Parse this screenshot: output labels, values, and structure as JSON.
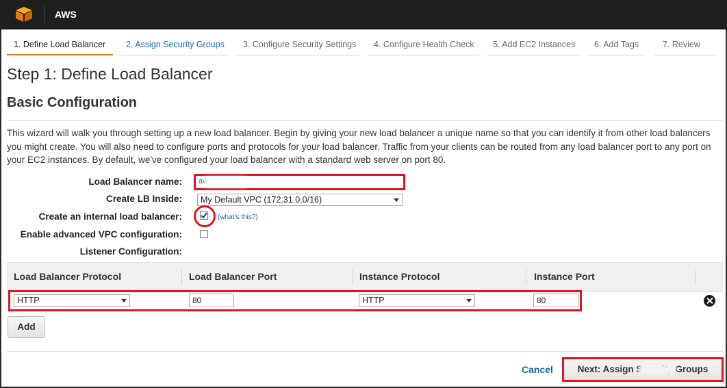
{
  "app": {
    "brand": "AWS"
  },
  "wizard": {
    "tabs": [
      {
        "label": "1. Define Load Balancer",
        "state": "active"
      },
      {
        "label": "2. Assign Security Groups",
        "state": "link"
      },
      {
        "label": "3. Configure Security Settings",
        "state": "inactive"
      },
      {
        "label": "4. Configure Health Check",
        "state": "inactive"
      },
      {
        "label": "5. Add EC2 Instances",
        "state": "inactive"
      },
      {
        "label": "6. Add Tags",
        "state": "inactive"
      },
      {
        "label": "7. Review",
        "state": "inactive"
      }
    ],
    "accent_color": "#e47911"
  },
  "page": {
    "step_title": "Step 1: Define Load Balancer",
    "section_title": "Basic Configuration",
    "intro": "This wizard will walk you through setting up a new load balancer. Begin by giving your new load balancer a unique name so that you can identify it from other load balancers you might create. You will also need to configure ports and protocols for your load balancer. Traffic from your clients can be routed from any load balancer port to any port on your EC2 instances. By default, we've configured your load balancer with a standard web server on port 80."
  },
  "form": {
    "name_label": "Load Balancer name:",
    "name_value": "aw",
    "inside_label": "Create LB Inside:",
    "inside_value": "My Default VPC (172.31.0.0/16)",
    "internal_label": "Create an internal load balancer:",
    "internal_checked": true,
    "whats_this": "(what's this?)",
    "advanced_label": "Enable advanced VPC configuration:",
    "advanced_checked": false,
    "listener_label": "Listener Configuration:"
  },
  "listeners": {
    "headers": [
      "Load Balancer Protocol",
      "Load Balancer Port",
      "Instance Protocol",
      "Instance Port"
    ],
    "rows": [
      {
        "lb_protocol": "HTTP",
        "lb_port": "80",
        "instance_protocol": "HTTP",
        "instance_port": "80"
      }
    ],
    "add_label": "Add"
  },
  "footer": {
    "cancel_label": "Cancel",
    "next_label": "Next: Assign Security Groups"
  },
  "annotation_color": "#e2141f"
}
